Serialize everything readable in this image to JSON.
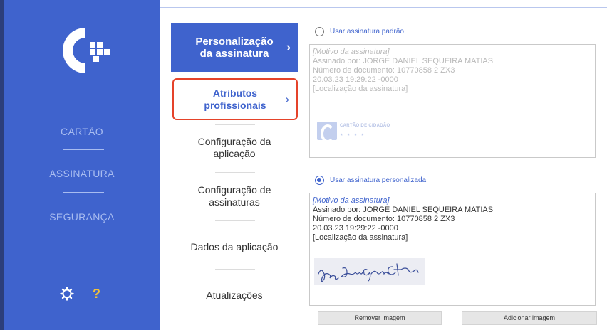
{
  "sidebar": {
    "items": [
      {
        "label": "CARTÃO"
      },
      {
        "label": "ASSINATURA"
      },
      {
        "label": "SEGURANÇA"
      }
    ],
    "help_label": "?",
    "colors": {
      "background": "#3f63cd",
      "text": "#a8bcf0",
      "help": "#f2c23a"
    }
  },
  "menu": {
    "items": [
      {
        "label_1": "Personalização",
        "label_2": "da assinatura",
        "chevron": "›"
      },
      {
        "label_1": "Atributos",
        "label_2": "profissionais",
        "chevron": "›"
      },
      {
        "label_1": "Configuração da",
        "label_2": "aplicação"
      },
      {
        "label_1": "Configuração de",
        "label_2": "assinaturas"
      },
      {
        "label_1": "Dados da aplicação"
      },
      {
        "label_1": "Atualizações"
      }
    ]
  },
  "content": {
    "default_option": {
      "label": "Usar assinatura padrão",
      "selected": false
    },
    "custom_option": {
      "label": "Usar assinatura personalizada",
      "selected": true
    },
    "preview": {
      "motivo": "[Motivo da assinatura]",
      "signed_by": "Assinado por: JORGE DANIEL SEQUEIRA MATIAS",
      "document_number": "Número de documento: 10770858 2 ZX3",
      "datetime": "20.03.23 19:29:22 -0000",
      "location": "[Localização da assinatura]"
    },
    "default_logo_text": "CARTÃO DE CIDADÃO",
    "default_logo_stars": "★ ★ ★ ★",
    "remove_image_label": "Remover imagem",
    "add_image_label": "Adicionar imagem"
  }
}
